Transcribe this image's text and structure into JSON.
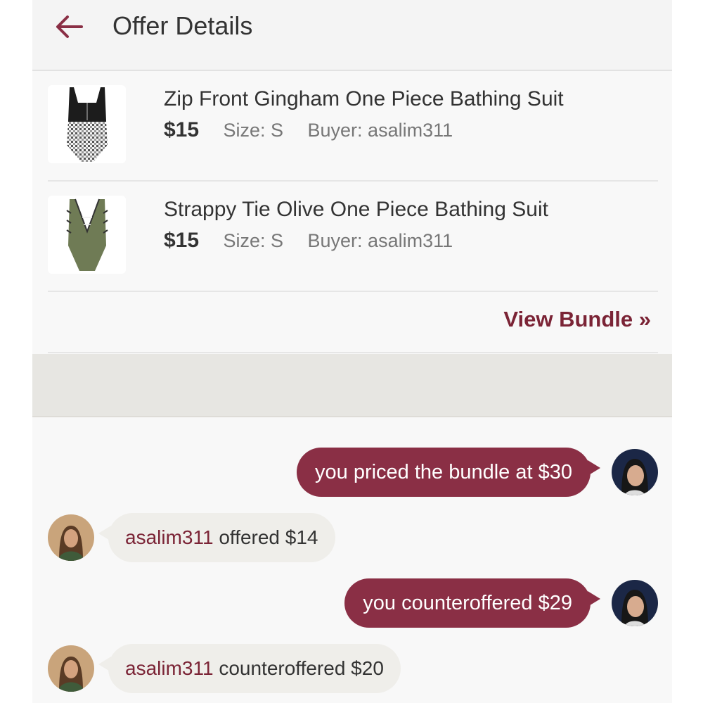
{
  "header": {
    "title": "Offer Details",
    "back_icon": "arrow-left-icon"
  },
  "items": [
    {
      "title": "Zip Front Gingham One Piece Bathing Suit",
      "price": "$15",
      "size": "Size: S",
      "buyer": "Buyer: asalim311",
      "thumbnail": "gingham-swimsuit-thumbnail"
    },
    {
      "title": "Strappy Tie Olive One Piece Bathing Suit",
      "price": "$15",
      "size": "Size: S",
      "buyer": "Buyer: asalim311",
      "thumbnail": "olive-swimsuit-thumbnail"
    }
  ],
  "view_bundle": "View Bundle »",
  "messages": [
    {
      "side": "right",
      "text": "you priced the bundle at $30"
    },
    {
      "side": "left",
      "user": "asalim311",
      "text": " offered $14"
    },
    {
      "side": "right",
      "text": "you counteroffered $29"
    },
    {
      "side": "left",
      "user": "asalim311",
      "text": " counteroffered $20"
    }
  ],
  "colors": {
    "accent": "#7b2436",
    "bubble_right": "#8a2f45",
    "bubble_left": "#efeeea",
    "band": "#e7e6e2"
  }
}
